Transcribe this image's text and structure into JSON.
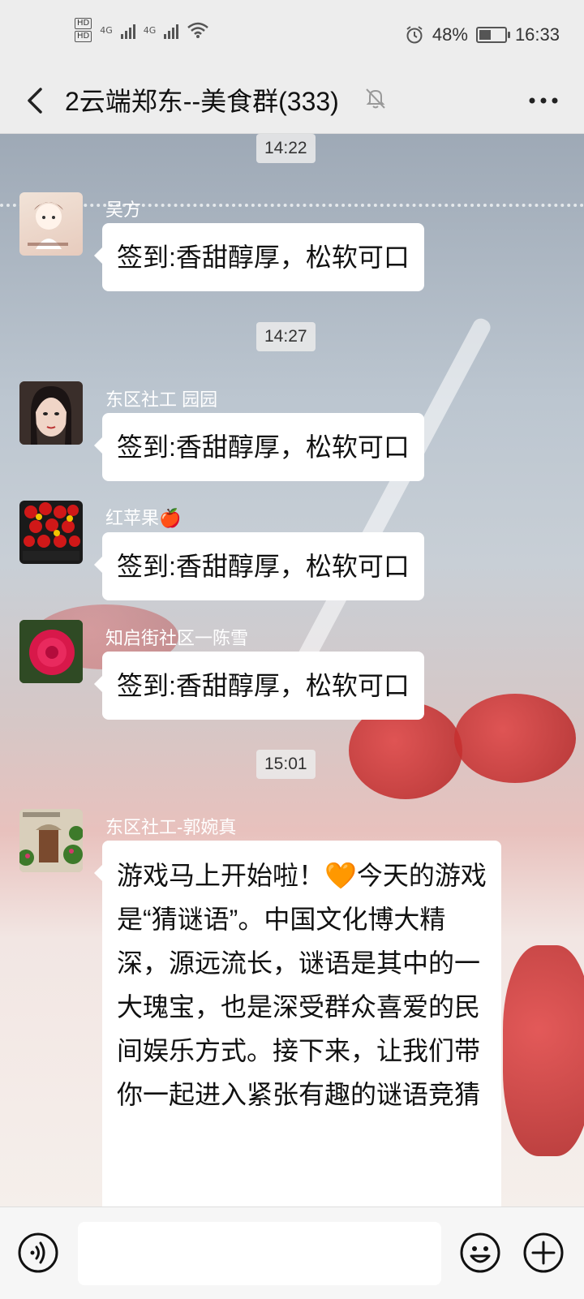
{
  "status_bar": {
    "hd1": "HD",
    "hd2": "HD",
    "net1": "4G",
    "net2": "4G",
    "battery_percent": "48%",
    "battery_level": 0.48,
    "time": "16:33"
  },
  "header": {
    "title": "2云端郑东--美食群(333)",
    "back_icon": "chevron-left-icon",
    "mute_icon": "bell-off-icon",
    "more_icon": "more-dots-icon"
  },
  "messages": [
    {
      "timestamp": "14:22"
    },
    {
      "sender": "吴方",
      "text": "签到:香甜醇厚，松软可口"
    },
    {
      "timestamp": "14:27"
    },
    {
      "sender": "东区社工 园园",
      "text": "签到:香甜醇厚，松软可口"
    },
    {
      "sender": "红苹果🍎",
      "text": "签到:香甜醇厚，松软可口"
    },
    {
      "sender": "知启街社区一陈雪",
      "text": "签到:香甜醇厚，松软可口"
    },
    {
      "timestamp": "15:01"
    },
    {
      "sender": "东区社工-郭婉真",
      "text": "游戏马上开始啦！🧡今天的游戏是“猜谜语”。中国文化博大精深，源远流长，谜语是其中的一大瑰宝，也是深受群众喜爱的民间娱乐方式。接下来，让我们带你一起进入紧张有趣的谜语竞猜"
    }
  ],
  "input_bar": {
    "voice_icon": "voice-icon",
    "emoji_icon": "emoji-icon",
    "plus_icon": "plus-circle-icon",
    "input_value": ""
  },
  "colors": {
    "bar_bg": "#ededed",
    "bubble_bg": "#ffffff",
    "name_text": "#ffffff"
  }
}
